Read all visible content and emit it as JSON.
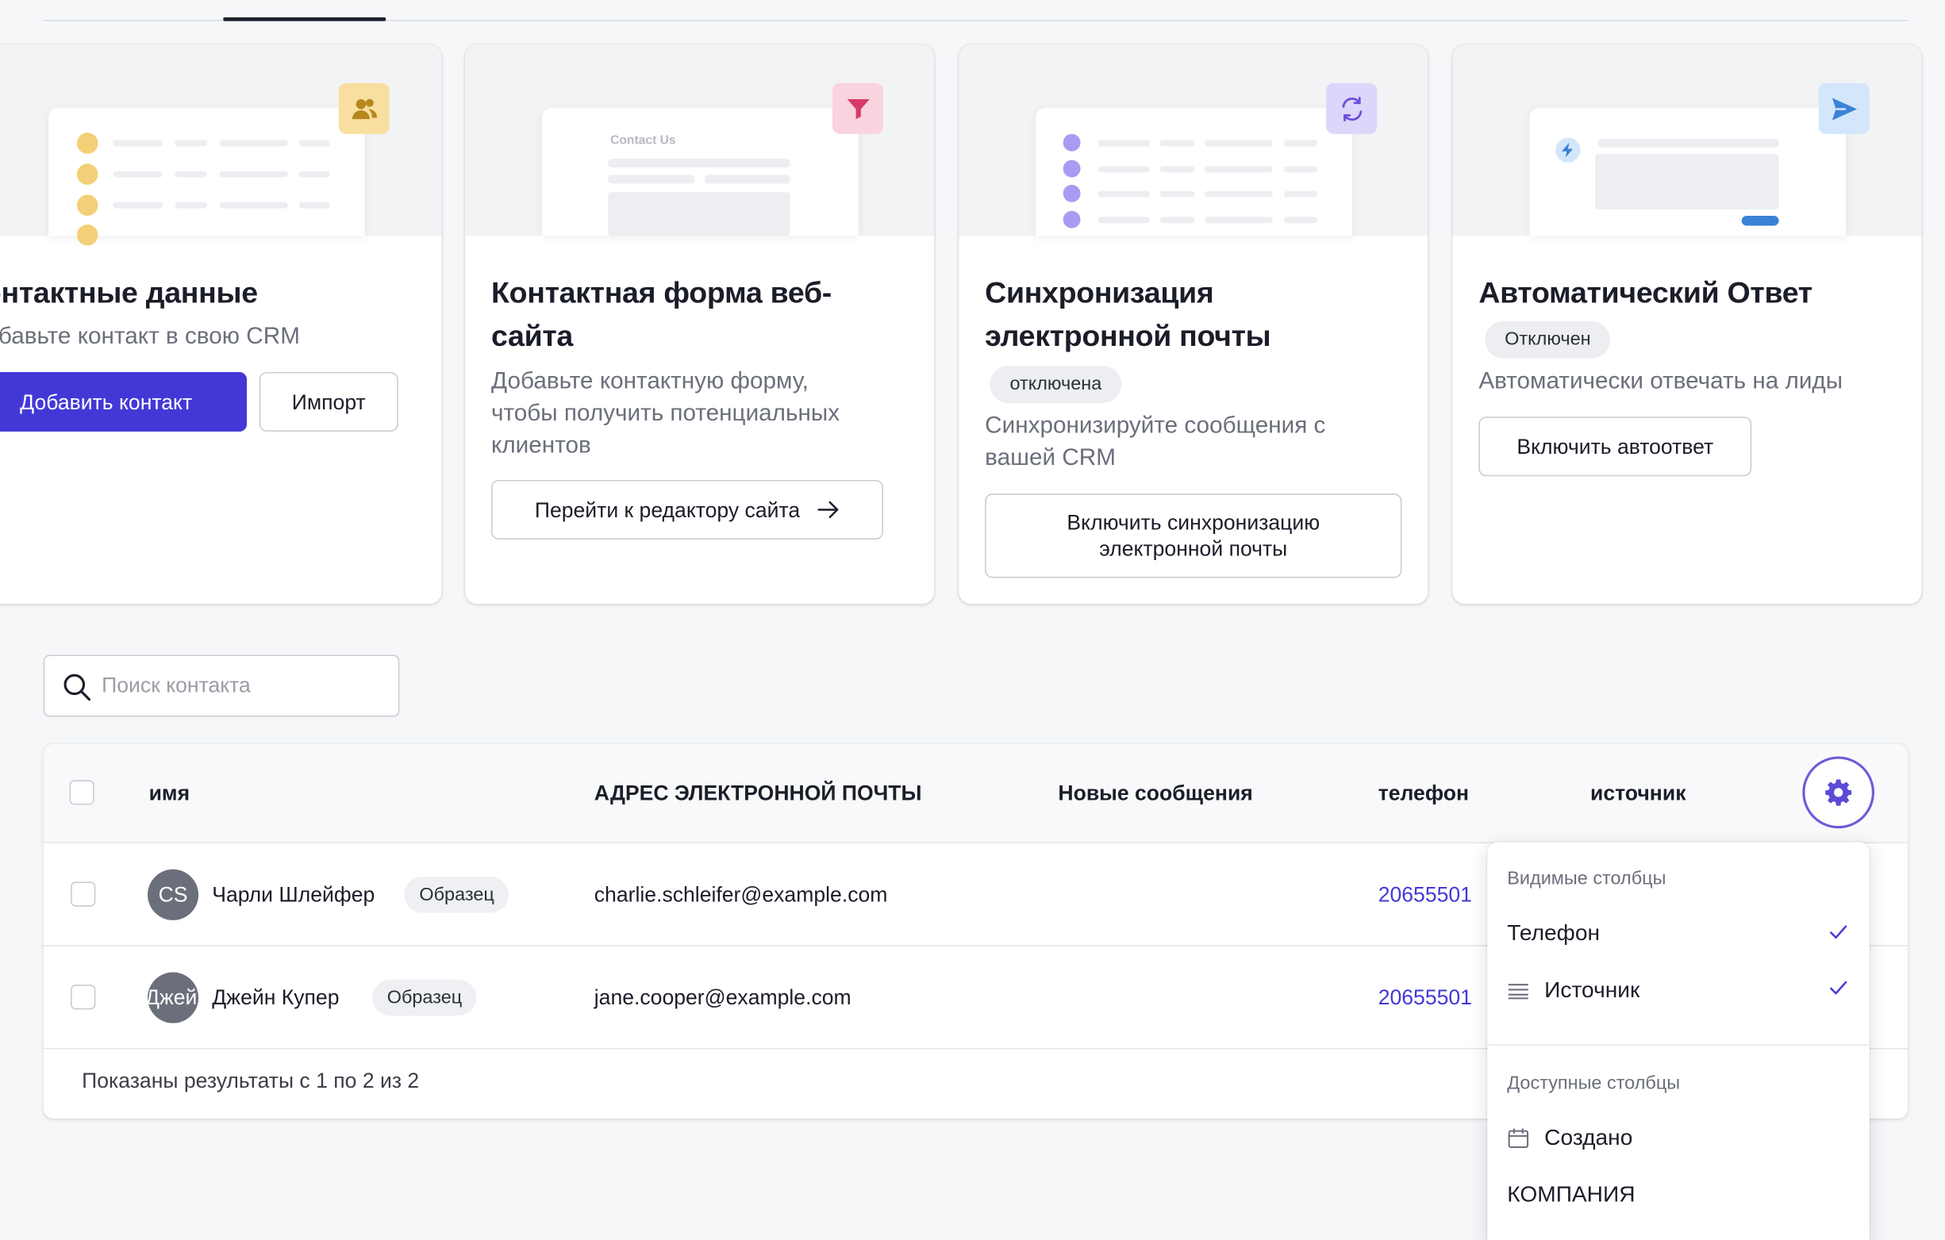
{
  "cards": [
    {
      "title": "контактные данные",
      "description": "Добавьте контакт в свою CRM",
      "primary_button": "Добавить контакт",
      "secondary_button": "Импорт",
      "icon": "users-icon",
      "icon_bg": "#f8dfa0"
    },
    {
      "title_line1": "Контактная форма веб-",
      "title_line2": "сайта",
      "description_line1": "Добавьте контактную форму,",
      "description_line2": "чтобы получить потенциальных",
      "description_line3": "клиентов",
      "button": "Перейти к редактору сайта",
      "mock_label": "Contact Us",
      "icon": "funnel-icon",
      "icon_bg": "#f9d3de"
    },
    {
      "title_line1": "Синхронизация",
      "title_line2": "электронной почты",
      "status": "отключена",
      "description_line1": "Синхронизируйте сообщения с",
      "description_line2": "вашей CRM",
      "button_line1": "Включить синхронизацию",
      "button_line2": "электронной почты",
      "icon": "sync-icon",
      "icon_bg": "#ddd6fb"
    },
    {
      "title": "Автоматический Ответ",
      "status": "Отключен",
      "description": "Автоматически отвечать на лиды",
      "button": "Включить автоответ",
      "icon": "send-icon",
      "icon_bg": "#d3e6fb"
    }
  ],
  "search": {
    "placeholder": "Поиск контакта"
  },
  "table": {
    "columns": [
      "имя",
      "АДРЕС ЭЛЕКТРОННОЙ ПОЧТЫ",
      "Новые сообщения",
      "телефон",
      "источник"
    ],
    "rows": [
      {
        "initials": "CS",
        "name": "Чарли Шлейфер",
        "tag": "Образец",
        "email": "charlie.schleifer@example.com",
        "phone": "20655501"
      },
      {
        "initials": "Джейн",
        "name": "Джейн Купер",
        "tag": "Образец",
        "email": "jane.cooper@example.com",
        "phone": "20655501"
      }
    ],
    "footer": "Показаны результаты с 1 по 2 из 2"
  },
  "column_menu": {
    "visible_heading": "Видимые столбцы",
    "visible": [
      {
        "label": "Телефон",
        "checked": true
      },
      {
        "label": "Источник",
        "checked": true,
        "icon": "list-icon"
      }
    ],
    "available_heading": "Доступные столбцы",
    "available": [
      {
        "label": "Создано",
        "icon": "calendar-icon"
      },
      {
        "label": "КОМПАНИЯ"
      }
    ]
  },
  "colors": {
    "accent": "#4338d6",
    "gear_border": "#6b5bd6"
  }
}
